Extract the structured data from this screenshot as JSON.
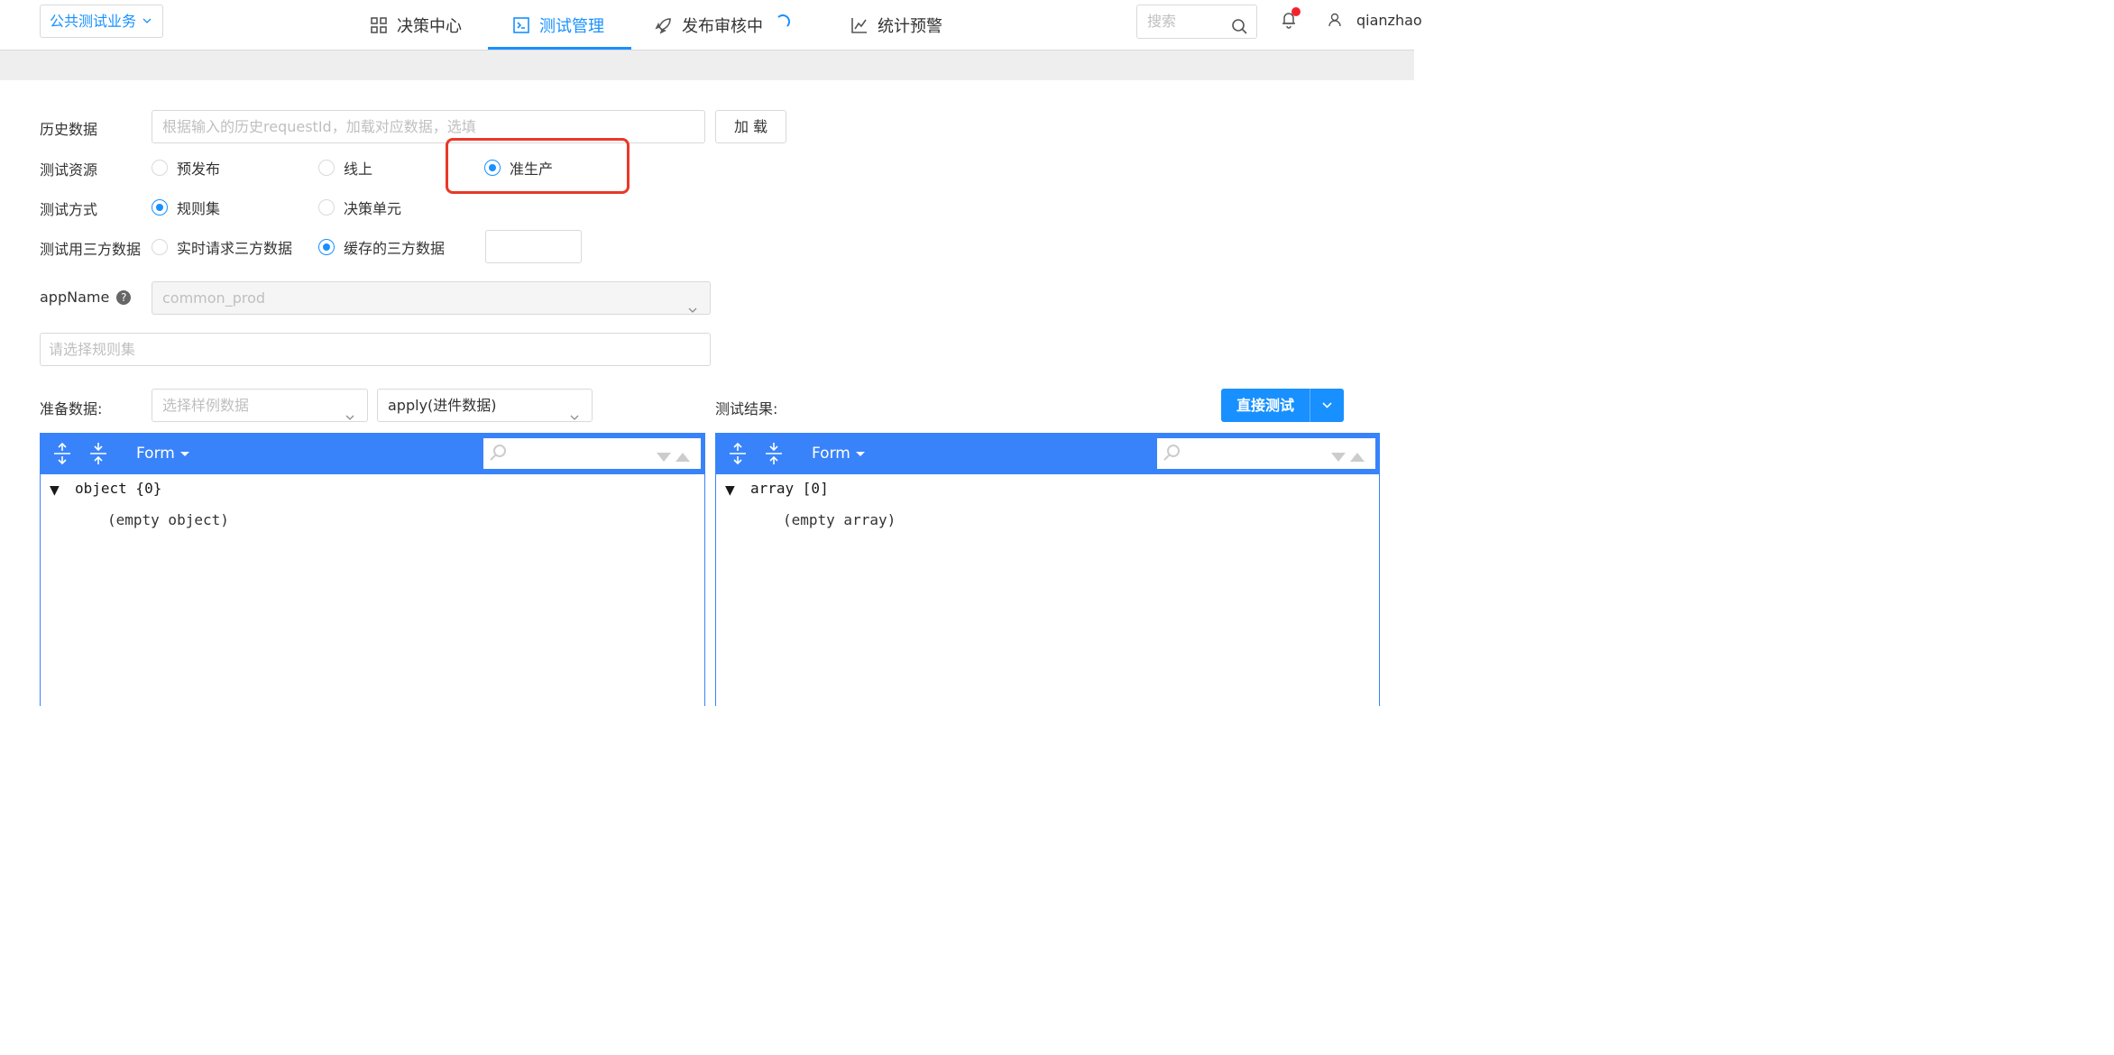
{
  "topbar": {
    "business_select": "公共测试业务",
    "nav": [
      {
        "label": "决策中心",
        "icon": "grid-icon"
      },
      {
        "label": "测试管理",
        "icon": "terminal-icon",
        "active": true
      },
      {
        "label": "发布审核中",
        "icon": "rocket-icon"
      },
      {
        "label": "统计预警",
        "icon": "line-chart-icon"
      }
    ],
    "search_placeholder": "搜索",
    "username": "qianzhao"
  },
  "form": {
    "history_label": "历史数据",
    "history_placeholder": "根据输入的历史requestId，加载对应数据，选填",
    "load_button": "加 载",
    "resource_label": "测试资源",
    "resource_options": [
      "预发布",
      "线上",
      "准生产"
    ],
    "resource_selected": "准生产",
    "method_label": "测试方式",
    "method_options": [
      "规则集",
      "决策单元"
    ],
    "method_selected": "规则集",
    "thirdparty_label": "测试用三方数据",
    "thirdparty_options": [
      "实时请求三方数据",
      "缓存的三方数据"
    ],
    "thirdparty_selected": "缓存的三方数据",
    "thirdparty_extra_value": "",
    "appname_label": "appName",
    "appname_help": "?",
    "appname_value": "common_prod",
    "ruleset_placeholder": "请选择规则集",
    "prepare_label": "准备数据:",
    "sample_placeholder": "选择样例数据",
    "apply_value": "apply(进件数据)",
    "result_label": "测试结果:",
    "test_button": "直接测试"
  },
  "editors": {
    "left": {
      "mode": "Form",
      "root": "object {0}",
      "empty": "(empty object)"
    },
    "right": {
      "mode": "Form",
      "root": "array [0]",
      "empty": "(empty array)"
    }
  },
  "colors": {
    "accent": "#1890ff",
    "editor_bar": "#3883fa",
    "highlight": "#e8392a"
  }
}
